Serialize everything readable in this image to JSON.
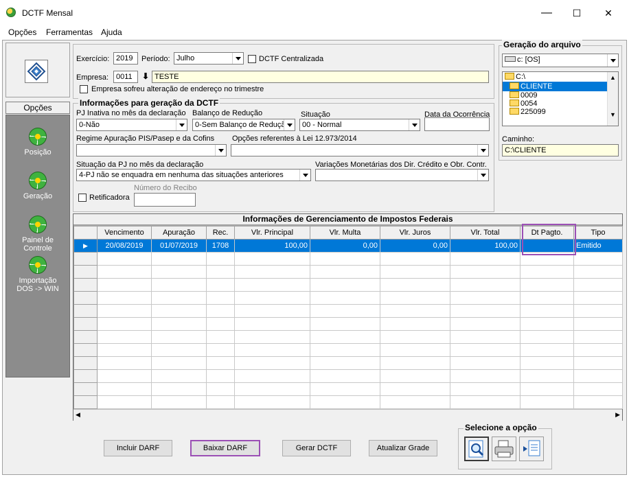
{
  "window": {
    "title": "DCTF Mensal",
    "minimize": "—",
    "maximize": "☐",
    "close": "✕"
  },
  "menu": {
    "opcoes": "Opções",
    "ferramentas": "Ferramentas",
    "ajuda": "Ajuda"
  },
  "sidebar": {
    "header": "Opções",
    "items": [
      {
        "label": "Posição",
        "icon": "globe-icon"
      },
      {
        "label": "Geração",
        "icon": "globe-icon"
      },
      {
        "label": "Painel de Controle",
        "icon": "globe-icon"
      },
      {
        "label": "Importação DOS -> WIN",
        "icon": "globe-icon"
      }
    ]
  },
  "top_form": {
    "exercicio_label": "Exercício:",
    "exercicio_value": "2019",
    "periodo_label": "Período:",
    "periodo_value": "Julho",
    "centralizada_label": "DCTF Centralizada",
    "empresa_label": "Empresa:",
    "empresa_code": "0011",
    "empresa_name": "TESTE",
    "endereco_label": "Empresa sofreu alteração de endereço no trimestre"
  },
  "info_dctf": {
    "title": "Informações para geração da DCTF",
    "pj_inativa_label": "PJ Inativa no mês da declaração",
    "pj_inativa_value": "0-Não",
    "balanco_label": "Balanço de Redução",
    "balanco_value": "0-Sem Balanço de Reduçã",
    "situacao_label": "Situação",
    "situacao_value": "00 - Normal",
    "data_ocorrencia_label": "Data da Ocorrência",
    "regime_label": "Regime Apuração PIS/Pasep e da Cofins",
    "opcoes_lei_label": "Opções referentes à Lei 12.973/2014",
    "situacao_pj_label": "Situação da PJ no mês da declaração",
    "situacao_pj_value": "4-PJ não se enquadra em nenhuma das situações anteriores",
    "variacoes_label": "Variações Monetárias dos Dir. Crédito e Obr. Contr.",
    "retificadora_label": "Retificadora",
    "numero_recibo_label": "Número do Recibo"
  },
  "geracao": {
    "title": "Geração do arquivo",
    "drive": "c: [OS]",
    "folders": [
      "C:\\",
      "CLIENTE",
      "0009",
      "0054",
      "225099"
    ],
    "selected_folder": "CLIENTE",
    "caminho_label": "Caminho:",
    "caminho_value": "C:\\CLIENTE"
  },
  "grid": {
    "title": "Informações de Gerenciamento de Impostos Federais",
    "columns": [
      "Vencimento",
      "Apuração",
      "Rec.",
      "Vlr. Principal",
      "Vlr. Multa",
      "Vlr. Juros",
      "Vlr. Total",
      "Dt Pagto.",
      "Tipo"
    ],
    "rows": [
      [
        "20/08/2019",
        "01/07/2019",
        "1708",
        "100,00",
        "0,00",
        "0,00",
        "100,00",
        "",
        "Emitido"
      ]
    ]
  },
  "buttons": {
    "incluir": "Incluir DARF",
    "baixar": "Baixar DARF",
    "gerar": "Gerar DCTF",
    "atualizar": "Atualizar Grade",
    "selecione_title": "Selecione a opção"
  },
  "colors": {
    "highlight": "#9b4fb5",
    "selection": "#0078d7"
  }
}
